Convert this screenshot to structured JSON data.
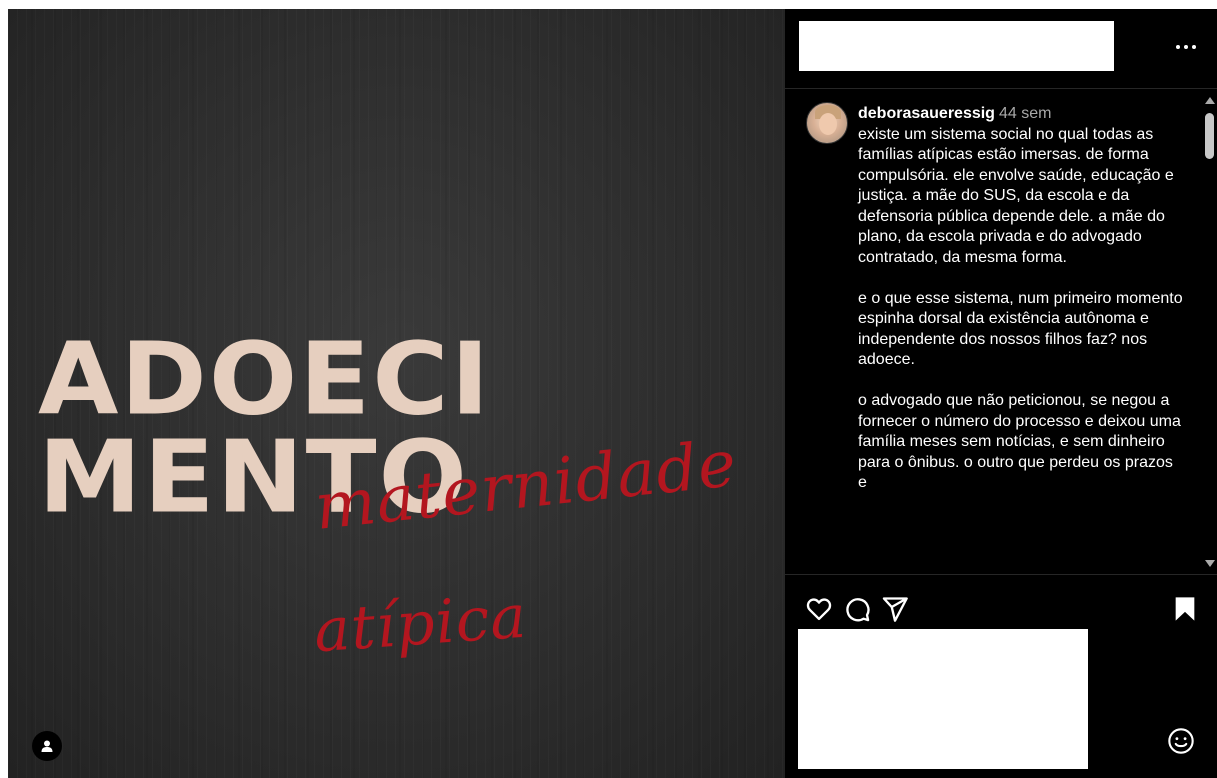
{
  "post_image": {
    "headline_line1": "ADOECI",
    "headline_line2": "MENTO",
    "script_word1": "maternidade",
    "script_word2": "atípica"
  },
  "panel": {
    "more_icon": "more-horizontal-icon",
    "author": {
      "username": "deborasaueressig",
      "time_ago": "44 sem"
    },
    "caption_paragraphs": [
      "existe um sistema social no qual todas as famílias atípicas estão imersas. de forma compulsória. ele envolve saúde, educação e justiça. a mãe do SUS, da escola e da defensoria pública depende dele. a mãe do plano, da escola privada e do advogado contratado, da mesma forma.",
      "e o que esse sistema, num primeiro momento espinha dorsal da existência autônoma e independente dos nossos filhos faz? nos adoece.",
      "o advogado que não peticionou, se negou a fornecer o número do processo e deixou uma família meses sem notícias, e sem dinheiro para o ônibus. o outro que perdeu os prazos e"
    ],
    "actions": {
      "like_icon": "heart-icon",
      "comment_icon": "comment-bubble-icon",
      "share_icon": "paper-plane-icon",
      "save_icon": "bookmark-icon"
    },
    "emoji_icon": "smiley-icon"
  },
  "colors": {
    "panel_bg": "#000000",
    "headline": "#e6cfbf",
    "script": "#b3161f",
    "secondary_text": "#a8a8a8"
  }
}
